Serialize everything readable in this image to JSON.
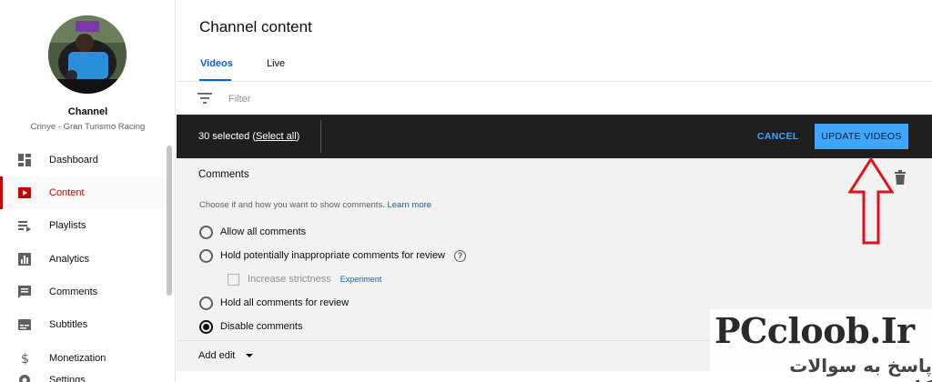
{
  "sidebar": {
    "channel_label": "Channel",
    "channel_name": "Crinye - Gran Turismo Racing",
    "items": [
      {
        "label": "Dashboard",
        "icon": "dashboard-icon"
      },
      {
        "label": "Content",
        "icon": "content-icon",
        "active": true
      },
      {
        "label": "Playlists",
        "icon": "playlists-icon"
      },
      {
        "label": "Analytics",
        "icon": "analytics-icon"
      },
      {
        "label": "Comments",
        "icon": "comments-icon"
      },
      {
        "label": "Subtitles",
        "icon": "subtitles-icon"
      },
      {
        "label": "Monetization",
        "icon": "monetization-icon"
      },
      {
        "label": "Settings",
        "icon": "settings-icon"
      }
    ]
  },
  "main": {
    "title": "Channel content",
    "tabs": [
      {
        "label": "Videos",
        "active": true
      },
      {
        "label": "Live"
      }
    ],
    "filter": {
      "placeholder": "Filter"
    },
    "selection_bar": {
      "count_text": "30 selected",
      "select_all": "Select all",
      "cancel_label": "CANCEL",
      "update_label": "UPDATE VIDEOS"
    },
    "edit_panel": {
      "title": "Comments",
      "description": "Choose if and how you want to show comments.",
      "learn_more": "Learn more",
      "options": [
        {
          "label": "Allow all comments",
          "checked": false
        },
        {
          "label": "Hold potentially inappropriate comments for review",
          "checked": false,
          "help": true
        },
        {
          "label": "Hold all comments for review",
          "checked": false
        },
        {
          "label": "Disable comments",
          "checked": true
        }
      ],
      "strictness_label": "Increase strictness",
      "experiment_tag": "Experiment",
      "add_edit": "Add edit"
    }
  },
  "watermark": {
    "title": "PCcloob.Ir",
    "subtitle": "پاسخ به سوالات کامپیوتری"
  },
  "colors": {
    "accent_blue": "#065fd4",
    "button_blue": "#3ea6ff",
    "active_red": "#cc0000",
    "annotation_red": "#e0101e"
  }
}
